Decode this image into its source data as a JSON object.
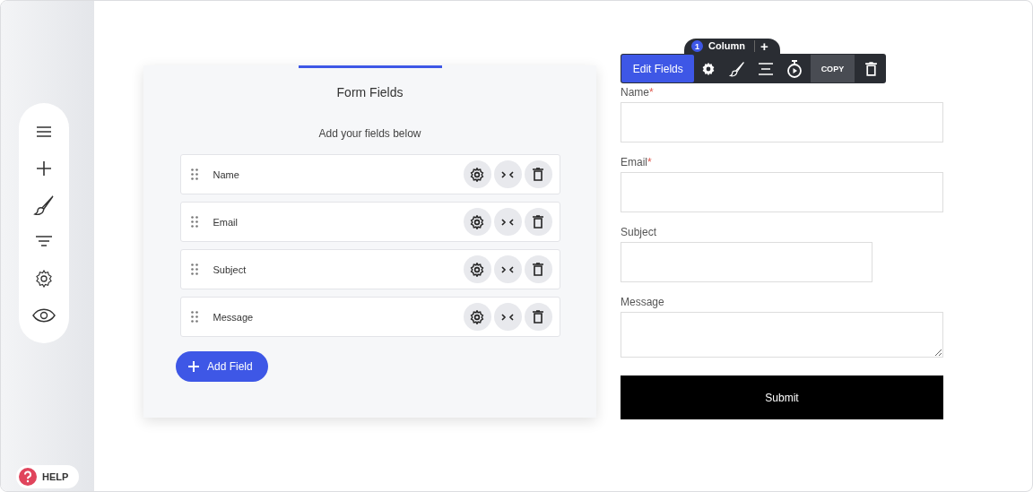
{
  "sidebar": {
    "items": [
      {
        "kind": "menu"
      },
      {
        "kind": "add"
      },
      {
        "kind": "brush"
      },
      {
        "kind": "filter"
      },
      {
        "kind": "settings"
      },
      {
        "kind": "preview"
      }
    ]
  },
  "help": {
    "label": "HELP"
  },
  "fields_panel": {
    "title": "Form Fields",
    "subtitle": "Add your fields below",
    "fields": [
      {
        "label": "Name"
      },
      {
        "label": "Email"
      },
      {
        "label": "Subject"
      },
      {
        "label": "Message"
      }
    ],
    "add_button": "Add Field"
  },
  "column_tab": {
    "number": "1",
    "label": "Column",
    "add": "+"
  },
  "toolbar": {
    "edit_button": "Edit Fields",
    "copy_button": "COPY"
  },
  "form": {
    "fields": [
      {
        "label": "Name",
        "required_mark": "*",
        "kind": "input",
        "wide": true
      },
      {
        "label": "Email",
        "required_mark": "*",
        "kind": "input",
        "wide": true
      },
      {
        "label": "Subject",
        "kind": "input",
        "wide": false
      },
      {
        "label": "Message",
        "kind": "textarea",
        "wide": true
      }
    ],
    "submit": "Submit"
  }
}
